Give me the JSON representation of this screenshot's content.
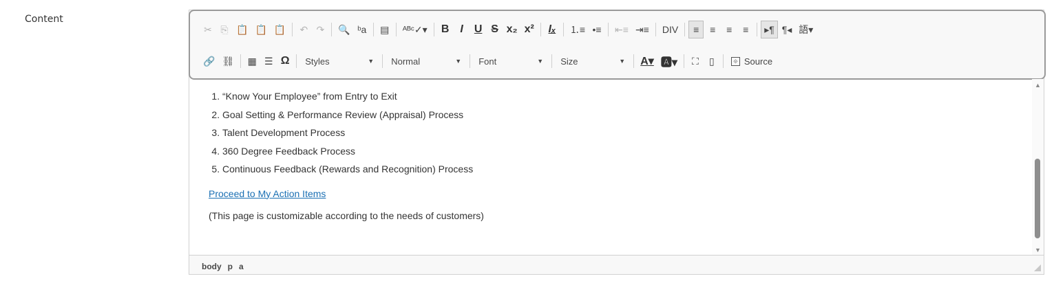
{
  "field": {
    "label": "Content"
  },
  "toolbar": {
    "row1": [
      {
        "name": "cut-icon",
        "glyph": "✂",
        "disabled": true
      },
      {
        "name": "copy-icon",
        "glyph": "⎘",
        "disabled": true
      },
      {
        "name": "paste-icon",
        "glyph": "📋",
        "disabled": false
      },
      {
        "name": "paste-text-icon",
        "glyph": "📋",
        "disabled": false
      },
      {
        "name": "paste-word-icon",
        "glyph": "📋",
        "disabled": false
      },
      {
        "sep": true
      },
      {
        "name": "undo-icon",
        "glyph": "↶",
        "disabled": true
      },
      {
        "name": "redo-icon",
        "glyph": "↷",
        "disabled": true
      },
      {
        "sep": true
      },
      {
        "name": "find-icon",
        "glyph": "🔍",
        "disabled": false
      },
      {
        "name": "replace-icon",
        "glyph": "ᵇa",
        "disabled": false
      },
      {
        "sep": true
      },
      {
        "name": "select-all-icon",
        "glyph": "▤",
        "disabled": false
      },
      {
        "sep": true
      },
      {
        "name": "spellcheck-icon",
        "glyph": "ᴬᴮᶜ✓▾",
        "disabled": false
      },
      {
        "sep": true
      },
      {
        "name": "bold-button",
        "glyph": "B",
        "bold": true
      },
      {
        "name": "italic-button",
        "glyph": "I",
        "bold": true,
        "italic": true
      },
      {
        "name": "underline-button",
        "glyph": "U",
        "bold": true,
        "underline": true
      },
      {
        "name": "strike-button",
        "glyph": "S",
        "bold": true,
        "strike": true
      },
      {
        "name": "subscript-button",
        "glyph": "x₂",
        "bold": true
      },
      {
        "name": "superscript-button",
        "glyph": "x²",
        "bold": true
      },
      {
        "sep": true
      },
      {
        "name": "remove-format-icon",
        "glyph": "Iₓ",
        "bold": true,
        "italic": true,
        "underline": true
      },
      {
        "sep": true
      },
      {
        "name": "numbered-list-icon",
        "glyph": "⒈≡",
        "disabled": false
      },
      {
        "name": "bulleted-list-icon",
        "glyph": "•≡",
        "disabled": false
      },
      {
        "sep": true
      },
      {
        "name": "outdent-icon",
        "glyph": "⇤≡",
        "disabled": true
      },
      {
        "name": "indent-icon",
        "glyph": "⇥≡",
        "disabled": false
      },
      {
        "sep": true
      },
      {
        "name": "div-icon",
        "glyph": "DIV",
        "disabled": false
      },
      {
        "sep": true
      },
      {
        "name": "align-left-icon",
        "glyph": "≡",
        "active": true
      },
      {
        "name": "align-center-icon",
        "glyph": "≡"
      },
      {
        "name": "align-right-icon",
        "glyph": "≡"
      },
      {
        "name": "justify-icon",
        "glyph": "≡"
      },
      {
        "sep": true
      },
      {
        "name": "ltr-icon",
        "glyph": "▸¶",
        "active": true
      },
      {
        "name": "rtl-icon",
        "glyph": "¶◂"
      },
      {
        "name": "language-icon",
        "glyph": "語▾"
      }
    ],
    "row2_icons_a": [
      {
        "name": "link-icon",
        "glyph": "🔗"
      },
      {
        "name": "unlink-icon",
        "glyph": "⛓"
      },
      {
        "sep": true
      },
      {
        "name": "table-icon",
        "glyph": "▦"
      },
      {
        "name": "horizontal-rule-icon",
        "glyph": "☰"
      },
      {
        "name": "special-char-icon",
        "glyph": "Ω",
        "bold": true
      },
      {
        "sep": true
      }
    ],
    "combos": {
      "styles": "Styles",
      "format": "Normal",
      "font": "Font",
      "size": "Size"
    },
    "row2_icons_b": [
      {
        "name": "text-color-icon",
        "glyph": "A▾",
        "bold": true,
        "underline": true
      },
      {
        "name": "bg-color-icon",
        "glyph": "🅰▾",
        "bold": true
      },
      {
        "sep": true
      },
      {
        "name": "maximize-icon",
        "glyph": "⛶"
      },
      {
        "name": "show-blocks-icon",
        "glyph": "▯"
      },
      {
        "sep": true
      }
    ],
    "source_label": "Source"
  },
  "content": {
    "items": [
      "“Know Your Employee” from Entry to Exit",
      "Goal Setting & Performance Review (Appraisal) Process",
      "Talent Development Process",
      "360 Degree Feedback Process",
      "Continuous Feedback (Rewards and Recognition) Process"
    ],
    "link_text": "Proceed to My Action Items",
    "note": "(This page is customizable according to the needs of customers)"
  },
  "status": {
    "path": [
      "body",
      "p",
      "a"
    ]
  },
  "colors": {
    "link": "#1a6fb3",
    "toolbar_border": "#999999"
  }
}
